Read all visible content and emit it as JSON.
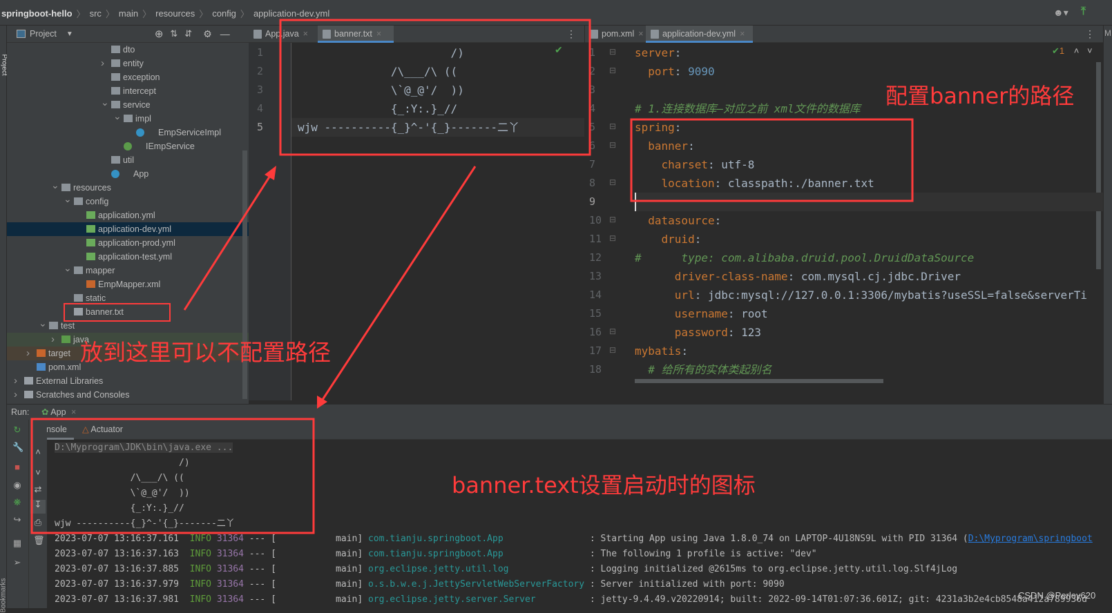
{
  "breadcrumb": [
    "springboot-hello",
    "src",
    "main",
    "resources",
    "config",
    "application-dev.yml"
  ],
  "project_panel": {
    "title": "Project",
    "strip_label": "Project",
    "bookmarks_label": "Bookmarks"
  },
  "tree": [
    {
      "label": "dto",
      "level": 7,
      "icon": "folder",
      "chevron": ""
    },
    {
      "label": "entity",
      "level": 7,
      "icon": "folder",
      "chevron": "right"
    },
    {
      "label": "exception",
      "level": 7,
      "icon": "folder",
      "chevron": ""
    },
    {
      "label": "intercept",
      "level": 7,
      "icon": "folder",
      "chevron": ""
    },
    {
      "label": "service",
      "level": 7,
      "icon": "folder",
      "chevron": "down"
    },
    {
      "label": "impl",
      "level": 8,
      "icon": "folder",
      "chevron": "down"
    },
    {
      "label": "EmpServiceImpl",
      "level": 9,
      "icon": "class",
      "chevron": ""
    },
    {
      "label": "IEmpService",
      "level": 8,
      "icon": "interface",
      "chevron": ""
    },
    {
      "label": "util",
      "level": 7,
      "icon": "folder",
      "chevron": ""
    },
    {
      "label": "App",
      "level": 7,
      "icon": "spring-class",
      "chevron": ""
    },
    {
      "label": "resources",
      "level": 3,
      "icon": "resources-folder",
      "chevron": "down"
    },
    {
      "label": "config",
      "level": 4,
      "icon": "folder",
      "chevron": "down"
    },
    {
      "label": "application.yml",
      "level": 5,
      "icon": "spring-yml",
      "chevron": ""
    },
    {
      "label": "application-dev.yml",
      "level": 5,
      "icon": "spring-yml",
      "chevron": "",
      "selected": true
    },
    {
      "label": "application-prod.yml",
      "level": 5,
      "icon": "spring-yml",
      "chevron": ""
    },
    {
      "label": "application-test.yml",
      "level": 5,
      "icon": "spring-yml",
      "chevron": ""
    },
    {
      "label": "mapper",
      "level": 4,
      "icon": "folder",
      "chevron": "down"
    },
    {
      "label": "EmpMapper.xml",
      "level": 5,
      "icon": "xml-file",
      "chevron": ""
    },
    {
      "label": "static",
      "level": 4,
      "icon": "folder",
      "chevron": ""
    },
    {
      "label": "banner.txt",
      "level": 4,
      "icon": "text-file",
      "chevron": ""
    },
    {
      "label": "test",
      "level": 2,
      "icon": "folder",
      "chevron": "down"
    },
    {
      "label": "java",
      "level": 3,
      "icon": "test-folder",
      "chevron": "right",
      "highlight": "test"
    },
    {
      "label": "target",
      "level": 1,
      "icon": "excluded-folder",
      "chevron": "right",
      "highlight": "excluded"
    },
    {
      "label": "pom.xml",
      "level": 1,
      "icon": "maven-file",
      "chevron": ""
    },
    {
      "label": "External Libraries",
      "level": 0,
      "icon": "libraries",
      "chevron": "right"
    },
    {
      "label": "Scratches and Consoles",
      "level": 0,
      "icon": "scratches",
      "chevron": "right"
    }
  ],
  "left_editor": {
    "tabs": [
      {
        "label": "App.java",
        "active": false
      },
      {
        "label": "banner.txt",
        "active": true
      }
    ],
    "lines": [
      "                       /)",
      "              /\\___/\\ ((",
      "              \\`@_@'/  ))",
      "              {_:Y:.}_//",
      "wjw ----------{_}^-'{_}-------二丫"
    ],
    "current_line": 5
  },
  "right_editor": {
    "tabs": [
      {
        "label": "pom.xml",
        "active": false
      },
      {
        "label": "application-dev.yml",
        "active": true
      }
    ],
    "inspection_count": "1",
    "current_line": 9,
    "lines": [
      [
        {
          "t": "server",
          "c": "k"
        },
        {
          "t": ":",
          "c": "v"
        }
      ],
      [
        {
          "t": "  port",
          "c": "k"
        },
        {
          "t": ": ",
          "c": "v"
        },
        {
          "t": "9090",
          "c": "n"
        }
      ],
      [],
      [
        {
          "t": "# 1.连接数据库—对应之前 xml文件的数据库",
          "c": "c"
        }
      ],
      [
        {
          "t": "spring",
          "c": "k"
        },
        {
          "t": ":",
          "c": "v"
        }
      ],
      [
        {
          "t": "  banner",
          "c": "k"
        },
        {
          "t": ":",
          "c": "v"
        }
      ],
      [
        {
          "t": "    charset",
          "c": "k"
        },
        {
          "t": ": utf-8",
          "c": "v"
        }
      ],
      [
        {
          "t": "    location",
          "c": "k"
        },
        {
          "t": ": classpath:./banner.txt",
          "c": "v"
        }
      ],
      [],
      [
        {
          "t": "  datasource",
          "c": "k"
        },
        {
          "t": ":",
          "c": "v"
        }
      ],
      [
        {
          "t": "    druid",
          "c": "k"
        },
        {
          "t": ":",
          "c": "v"
        }
      ],
      [
        {
          "t": "#      type: com.alibaba.druid.pool.DruidDataSource",
          "c": "c"
        }
      ],
      [
        {
          "t": "      driver-class-name",
          "c": "k"
        },
        {
          "t": ": com.mysql.cj.jdbc.Driver",
          "c": "v"
        }
      ],
      [
        {
          "t": "      url",
          "c": "k"
        },
        {
          "t": ": jdbc:mysql://127.0.0.1:3306/mybatis?useSSL=false&serverTi",
          "c": "v"
        }
      ],
      [
        {
          "t": "      username",
          "c": "k"
        },
        {
          "t": ": root",
          "c": "v"
        }
      ],
      [
        {
          "t": "      password",
          "c": "k"
        },
        {
          "t": ": 123",
          "c": "v"
        }
      ],
      [
        {
          "t": "mybatis",
          "c": "k"
        },
        {
          "t": ":",
          "c": "v"
        }
      ],
      [
        {
          "t": "  # 给所有的实体类起别名",
          "c": "c"
        }
      ]
    ]
  },
  "run": {
    "label": "Run:",
    "config": "App",
    "tabs": [
      {
        "label": "Console",
        "active": true
      },
      {
        "label": "Actuator",
        "active": false
      }
    ],
    "command": "D:\\Myprogram\\JDK\\bin\\java.exe ...",
    "banner": [
      "                       /)",
      "              /\\___/\\ ((",
      "              \\`@_@'/  ))",
      "              {_:Y:.}_//",
      "wjw ----------{_}^-'{_}-------二丫"
    ],
    "logs": [
      {
        "ts": "2023-07-07 13:16:37.161",
        "level": "INFO",
        "pid": "31364",
        "thread": "--- [           main]",
        "logger": "com.tianju.springboot.App",
        "msg": "Starting App using Java 1.8.0_74 on LAPTOP-4U18NS9L with PID 31364 (",
        "link": "D:\\Myprogram\\springboot"
      },
      {
        "ts": "2023-07-07 13:16:37.163",
        "level": "INFO",
        "pid": "31364",
        "thread": "--- [           main]",
        "logger": "com.tianju.springboot.App",
        "msg": "The following 1 profile is active: \"dev\""
      },
      {
        "ts": "2023-07-07 13:16:37.885",
        "level": "INFO",
        "pid": "31364",
        "thread": "--- [           main]",
        "logger": "org.eclipse.jetty.util.log",
        "msg": "Logging initialized @2615ms to org.eclipse.jetty.util.log.Slf4jLog"
      },
      {
        "ts": "2023-07-07 13:16:37.979",
        "level": "INFO",
        "pid": "31364",
        "thread": "--- [           main]",
        "logger": "o.s.b.w.e.j.JettyServletWebServerFactory",
        "msg": "Server initialized with port: 9090"
      },
      {
        "ts": "2023-07-07 13:16:37.981",
        "level": "INFO",
        "pid": "31364",
        "thread": "--- [           main]",
        "logger": "org.eclipse.jetty.server.Server",
        "msg": "jetty-9.4.49.v20220914; built: 2022-09-14T01:07:36.601Z; git: 4231a3b2e4cb8548a412a789936d"
      }
    ]
  },
  "annotations": {
    "tree_note": "放到这里可以不配置路径",
    "yaml_note": "配置banner的路径",
    "console_note": "banner.text设置启动时的图标",
    "color": "#ff3b3b"
  },
  "watermark": "CSDN @Perley620",
  "colors": {
    "editor_bg": "#2b2b2b",
    "panel_bg": "#3c3f41",
    "yaml_key": "#cc7832",
    "number": "#6897bb",
    "comment": "#629755",
    "selection": "#0d293e"
  }
}
